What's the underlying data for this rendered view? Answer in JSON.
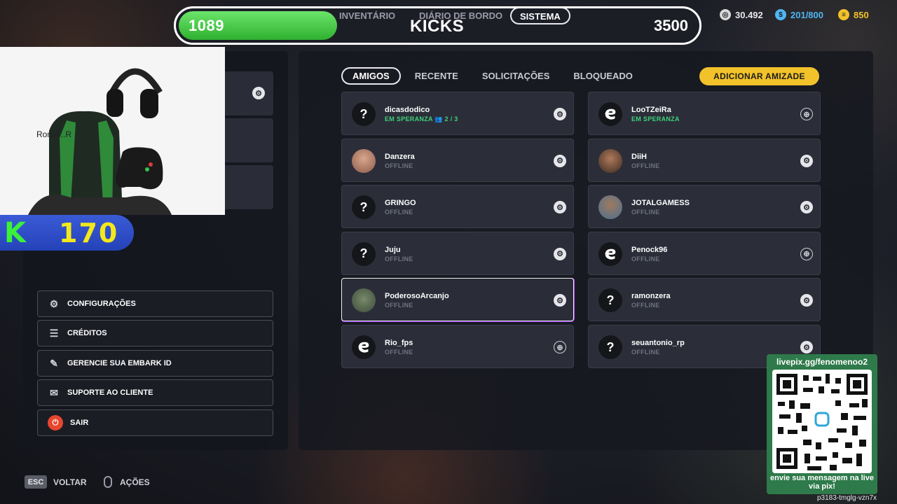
{
  "topbar": {
    "left_value": "1089",
    "title": "KICKS",
    "right_value": "3500",
    "nav": [
      "INVENTÁRIO",
      "DIÁRIO DE BORDO",
      "SISTEMA"
    ]
  },
  "currencies": [
    {
      "icon": "coin-icon",
      "value": "30.492",
      "color": "#e8e8ec"
    },
    {
      "icon": "token-icon",
      "value": "201/800",
      "color": "#4fb6f0"
    },
    {
      "icon": "gold-icon",
      "value": "850",
      "color": "#f2c22a"
    }
  ],
  "webcam": {
    "label": "Ronal...R"
  },
  "kbadge": {
    "value": "170"
  },
  "menu": [
    {
      "icon": "gear-icon",
      "label": "CONFIGURAÇÕES"
    },
    {
      "icon": "credits-icon",
      "label": "CRÉDITOS"
    },
    {
      "icon": "embark-id-icon",
      "label": "GERENCIE SUA EMBARK ID"
    },
    {
      "icon": "support-icon",
      "label": "SUPORTE AO CLIENTE"
    },
    {
      "icon": "power-icon",
      "label": "SAIR"
    }
  ],
  "tabs": [
    "AMIGOS",
    "RECENTE",
    "SOLICITAÇÕES",
    "BLOQUEADO"
  ],
  "add_friend_label": "ADICIONAR AMIZADE",
  "friends_left": [
    {
      "name": "dicasdodico",
      "status": "EM SPERANZA",
      "party": "2 / 3",
      "online": true,
      "avatar": "question",
      "platform": "steam"
    },
    {
      "name": "Danzera",
      "status": "OFFLINE",
      "online": false,
      "avatar": "photo",
      "platform": "steam"
    },
    {
      "name": "GRINGO",
      "status": "OFFLINE",
      "online": false,
      "avatar": "question",
      "platform": "steam"
    },
    {
      "name": "Juju",
      "status": "OFFLINE",
      "online": false,
      "avatar": "question",
      "platform": "steam"
    },
    {
      "name": "PoderosoArcanjo",
      "status": "OFFLINE",
      "online": false,
      "avatar": "photo4",
      "platform": "steam"
    },
    {
      "name": "Rio_fps",
      "status": "OFFLINE",
      "online": false,
      "avatar": "embark",
      "platform": "globe"
    }
  ],
  "friends_right": [
    {
      "name": "LooTZeiRa",
      "status": "EM SPERANZA",
      "online": true,
      "avatar": "embark",
      "platform": "globe"
    },
    {
      "name": "DiiH",
      "status": "OFFLINE",
      "online": false,
      "avatar": "photo2",
      "platform": "steam"
    },
    {
      "name": "JOTALGAMESS",
      "status": "OFFLINE",
      "online": false,
      "avatar": "photo3",
      "platform": "steam"
    },
    {
      "name": "Penock96",
      "status": "OFFLINE",
      "online": false,
      "avatar": "embark",
      "platform": "globe"
    },
    {
      "name": "ramonzera",
      "status": "OFFLINE",
      "online": false,
      "avatar": "question",
      "platform": "steam"
    },
    {
      "name": "seuantonio_rp",
      "status": "OFFLINE",
      "online": false,
      "avatar": "question",
      "platform": "steam"
    }
  ],
  "bottom": {
    "esc": "ESC",
    "back": "VOLTAR",
    "actions": "AÇÕES"
  },
  "qr": {
    "title": "livepix.gg/fenomenoo2",
    "message": "envie sua mensagem na live via pix!"
  },
  "code": "p3183-tmglg-vzn7x"
}
